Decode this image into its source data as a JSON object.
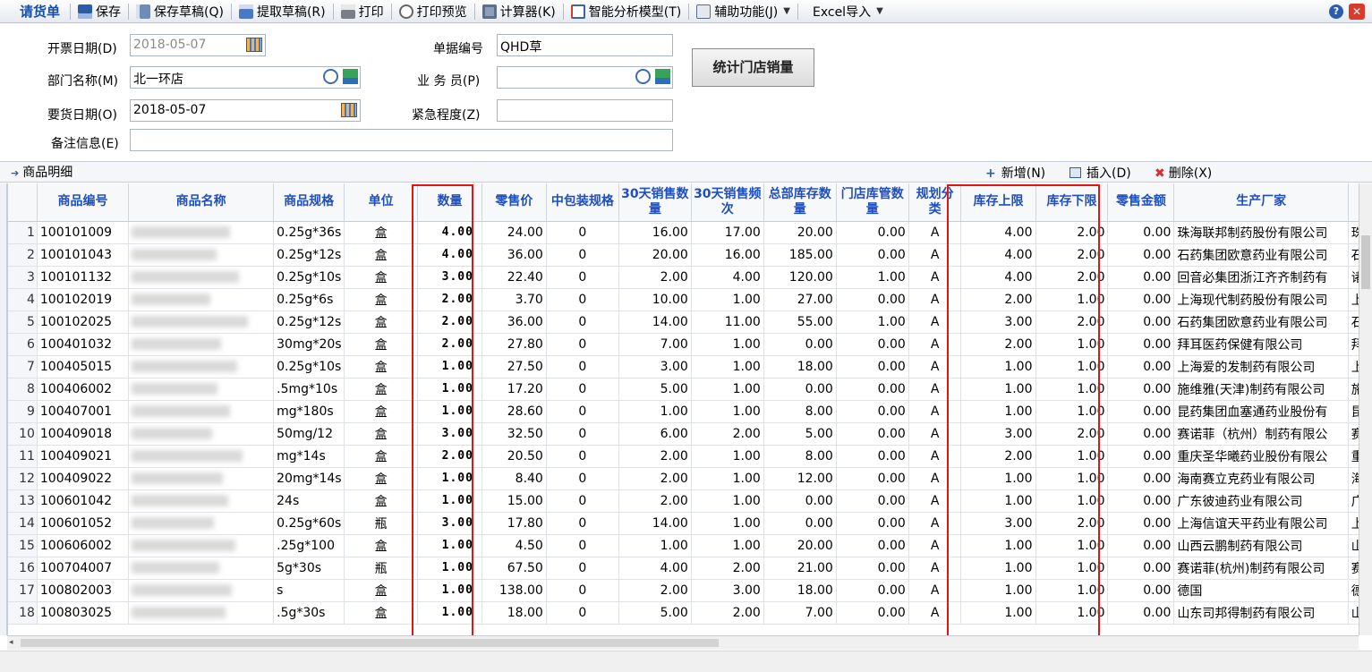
{
  "toolbar": {
    "title": "请货单",
    "save": "保存",
    "save_draft": "保存草稿(Q)",
    "fetch_draft": "提取草稿(R)",
    "print": "打印",
    "print_preview": "打印预览",
    "calculator": "计算器(K)",
    "smart_model": "智能分析模型(T)",
    "aux_function": "辅助功能(J)",
    "excel_import": "Excel导入"
  },
  "form": {
    "invoice_date_label": "开票日期(D)",
    "invoice_date_value": "2018-05-07",
    "doc_no_label": "单据编号",
    "doc_no_value": "QHD草",
    "dept_label": "部门名称(M)",
    "dept_value": "北一环店",
    "salesman_label": "业 务 员(P)",
    "salesman_value": "",
    "request_date_label": "要货日期(O)",
    "request_date_value": "2018-05-07",
    "urgency_label": "紧急程度(Z)",
    "urgency_value": "",
    "remark_label": "备注信息(E)",
    "remark_value": "",
    "stat_button": "统计门店销量"
  },
  "detail": {
    "title": "商品明细",
    "add": "新增(N)",
    "insert": "插入(D)",
    "delete": "删除(X)"
  },
  "grid": {
    "headers": [
      "商品编号",
      "商品名称",
      "商品规格",
      "单位",
      "数量",
      "零售价",
      "中包装规格",
      "30天销售数量",
      "30天销售频次",
      "总部库存数量",
      "门店库管数量",
      "规划分类",
      "库存上限",
      "库存下限",
      "零售金额",
      "生产厂家",
      ""
    ],
    "rows": [
      [
        "1",
        "100101009",
        "0.25g*36s",
        "盒",
        "4.00",
        "24.00",
        "0",
        "16.00",
        "17.00",
        "20.00",
        "0.00",
        "A",
        "4.00",
        "2.00",
        "0.00",
        "珠海联邦制药股份有限公司",
        "珠海"
      ],
      [
        "2",
        "100101043",
        "0.25g*12s",
        "盒",
        "4.00",
        "36.00",
        "0",
        "20.00",
        "16.00",
        "185.00",
        "0.00",
        "A",
        "4.00",
        "2.00",
        "0.00",
        "石药集团欧意药业有限公司",
        "石药"
      ],
      [
        "3",
        "100101132",
        "0.25g*10s",
        "盒",
        "3.00",
        "22.40",
        "0",
        "2.00",
        "4.00",
        "120.00",
        "1.00",
        "A",
        "4.00",
        "2.00",
        "0.00",
        "回音必集团浙江齐齐制药有",
        "诸暨"
      ],
      [
        "4",
        "100102019",
        "0.25g*6s",
        "盒",
        "2.00",
        "3.70",
        "0",
        "10.00",
        "1.00",
        "27.00",
        "0.00",
        "A",
        "2.00",
        "1.00",
        "0.00",
        "上海现代制药股份有限公司",
        "上海"
      ],
      [
        "5",
        "100102025",
        "0.25g*12s",
        "盒",
        "2.00",
        "36.00",
        "0",
        "14.00",
        "11.00",
        "55.00",
        "1.00",
        "A",
        "3.00",
        "2.00",
        "0.00",
        "石药集团欧意药业有限公司",
        "石药"
      ],
      [
        "6",
        "100401032",
        "30mg*20s",
        "盒",
        "2.00",
        "27.80",
        "0",
        "7.00",
        "1.00",
        "0.00",
        "0.00",
        "A",
        "2.00",
        "1.00",
        "0.00",
        "拜耳医药保健有限公司",
        "拜耳"
      ],
      [
        "7",
        "100405015",
        "0.25g*10s",
        "盒",
        "1.00",
        "27.50",
        "0",
        "3.00",
        "1.00",
        "18.00",
        "0.00",
        "A",
        "1.00",
        "1.00",
        "0.00",
        "上海爱的发制药有限公司",
        "上海"
      ],
      [
        "8",
        "100406002",
        ".5mg*10s",
        "盒",
        "1.00",
        "17.20",
        "0",
        "5.00",
        "1.00",
        "0.00",
        "0.00",
        "A",
        "1.00",
        "1.00",
        "0.00",
        "施维雅(天津)制药有限公司",
        "施维"
      ],
      [
        "9",
        "100407001",
        "mg*180s",
        "盒",
        "1.00",
        "28.60",
        "0",
        "1.00",
        "1.00",
        "8.00",
        "0.00",
        "A",
        "1.00",
        "1.00",
        "0.00",
        "昆药集团血塞通药业股份有",
        "昆药"
      ],
      [
        "10",
        "100409018",
        "50mg/12",
        "盒",
        "3.00",
        "32.50",
        "0",
        "6.00",
        "2.00",
        "5.00",
        "0.00",
        "A",
        "3.00",
        "2.00",
        "0.00",
        "赛诺菲（杭州）制药有限公",
        "赛诺"
      ],
      [
        "11",
        "100409021",
        "mg*14s",
        "盒",
        "2.00",
        "20.50",
        "0",
        "2.00",
        "1.00",
        "8.00",
        "0.00",
        "A",
        "2.00",
        "1.00",
        "0.00",
        "重庆圣华曦药业股份有限公",
        "重庆"
      ],
      [
        "12",
        "100409022",
        "20mg*14s",
        "盒",
        "1.00",
        "8.40",
        "0",
        "2.00",
        "1.00",
        "12.00",
        "0.00",
        "A",
        "1.00",
        "1.00",
        "0.00",
        "海南赛立克药业有限公司",
        "海南"
      ],
      [
        "13",
        "100601042",
        "24s",
        "盒",
        "1.00",
        "15.00",
        "0",
        "2.00",
        "1.00",
        "0.00",
        "0.00",
        "A",
        "1.00",
        "1.00",
        "0.00",
        "广东彼迪药业有限公司",
        "广东"
      ],
      [
        "14",
        "100601052",
        "0.25g*60s",
        "瓶",
        "3.00",
        "17.80",
        "0",
        "14.00",
        "1.00",
        "0.00",
        "0.00",
        "A",
        "3.00",
        "2.00",
        "0.00",
        "上海信谊天平药业有限公司",
        "上海"
      ],
      [
        "15",
        "100606002",
        ".25g*100",
        "盒",
        "1.00",
        "4.50",
        "0",
        "1.00",
        "1.00",
        "20.00",
        "0.00",
        "A",
        "1.00",
        "1.00",
        "0.00",
        "山西云鹏制药有限公司",
        "山西"
      ],
      [
        "16",
        "100704007",
        "5g*30s",
        "瓶",
        "1.00",
        "67.50",
        "0",
        "4.00",
        "2.00",
        "21.00",
        "0.00",
        "A",
        "1.00",
        "1.00",
        "0.00",
        "赛诺菲(杭州)制药有限公司",
        "赛诺"
      ],
      [
        "17",
        "100802003",
        "s",
        "盒",
        "1.00",
        "138.00",
        "0",
        "2.00",
        "3.00",
        "18.00",
        "0.00",
        "A",
        "1.00",
        "1.00",
        "0.00",
        "德国",
        "德国"
      ],
      [
        "18",
        "100803025",
        ".5g*30s",
        "盒",
        "1.00",
        "18.00",
        "0",
        "5.00",
        "2.00",
        "7.00",
        "0.00",
        "A",
        "1.00",
        "1.00",
        "0.00",
        "山东司邦得制药有限公司",
        "山东"
      ]
    ]
  }
}
